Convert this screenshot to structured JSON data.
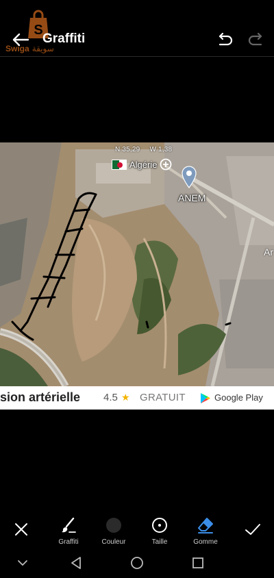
{
  "header": {
    "title": "Graffiti"
  },
  "watermark": {
    "brand": "Swiga",
    "brand_arabic": "سويقة"
  },
  "map": {
    "coord_lat": "N 35,29",
    "coord_lon": "W 1,38",
    "country": "Algérie",
    "place_label": "ANEM",
    "edge_label": "Ar"
  },
  "ad": {
    "text": "sion artérielle",
    "rating": "4.5",
    "star": "★",
    "price": "GRATUIT",
    "store": "Google Play"
  },
  "toolbar": {
    "graffiti_label": "Graffiti",
    "color_label": "Couleur",
    "size_label": "Taille",
    "eraser_label": "Gomme",
    "selected_tool": "Gomme",
    "current_color": "#2b2b2b",
    "accent_color": "#3b8ee8"
  },
  "icons": {
    "back": "arrow-left-icon",
    "undo": "undo-icon",
    "redo": "redo-icon",
    "close": "close-icon",
    "pen": "brush-icon",
    "size": "circle-dot-icon",
    "eraser": "eraser-icon",
    "confirm": "check-icon",
    "nav_hide": "chevron-down-icon",
    "nav_back": "triangle-back-icon",
    "nav_home": "circle-home-icon",
    "nav_recent": "square-recent-icon"
  }
}
